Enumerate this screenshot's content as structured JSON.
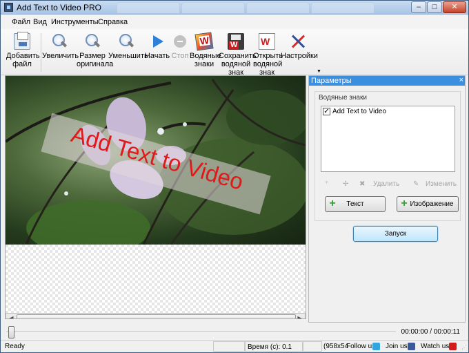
{
  "window": {
    "title": "Add Text to Video PRO",
    "controls": {
      "minimize": "–",
      "maximize": "□",
      "close": "✕"
    }
  },
  "menu": [
    "Файл",
    "Вид",
    "Инструменты",
    "Справка"
  ],
  "toolbar": {
    "add_file": [
      "Добавить",
      "файл"
    ],
    "zoom_in": "Увеличить",
    "original_size": [
      "Размер",
      "оригинала"
    ],
    "zoom_out": "Уменьшить",
    "start": "Начать",
    "stop": "Стоп",
    "watermarks": [
      "Водяные",
      "знаки"
    ],
    "save_watermark": [
      "Сохранить",
      "водяной",
      "знак"
    ],
    "open_watermark": [
      "Открыть",
      "водяной",
      "знак"
    ],
    "settings": "Настройки"
  },
  "preview": {
    "watermark_text": "Add Text to Video"
  },
  "panel": {
    "title": "Параметры",
    "close": "×",
    "group_label": "Водяные знаки",
    "list_items": [
      {
        "label": "Add Text to Video",
        "checked": true
      }
    ],
    "mini_toolbar": {
      "delete": "Удалить",
      "edit": "Изменить"
    },
    "text_button": "Текст",
    "image_button": "Изображение",
    "launch_button": "Запуск"
  },
  "timeline": {
    "time": "00:00:00 / 00:00:11",
    "position": 0
  },
  "status": {
    "ready": "Ready",
    "time_label": "Время (с): 0.1",
    "resolution": "(958x54",
    "follow": "Follow us",
    "join": "Join us",
    "watch": "Watch us"
  },
  "colors": {
    "panel_title_bg": "#3a8fe0",
    "watermark_text": "#e01a1a",
    "launch_button_border": "#3c7fb1"
  }
}
